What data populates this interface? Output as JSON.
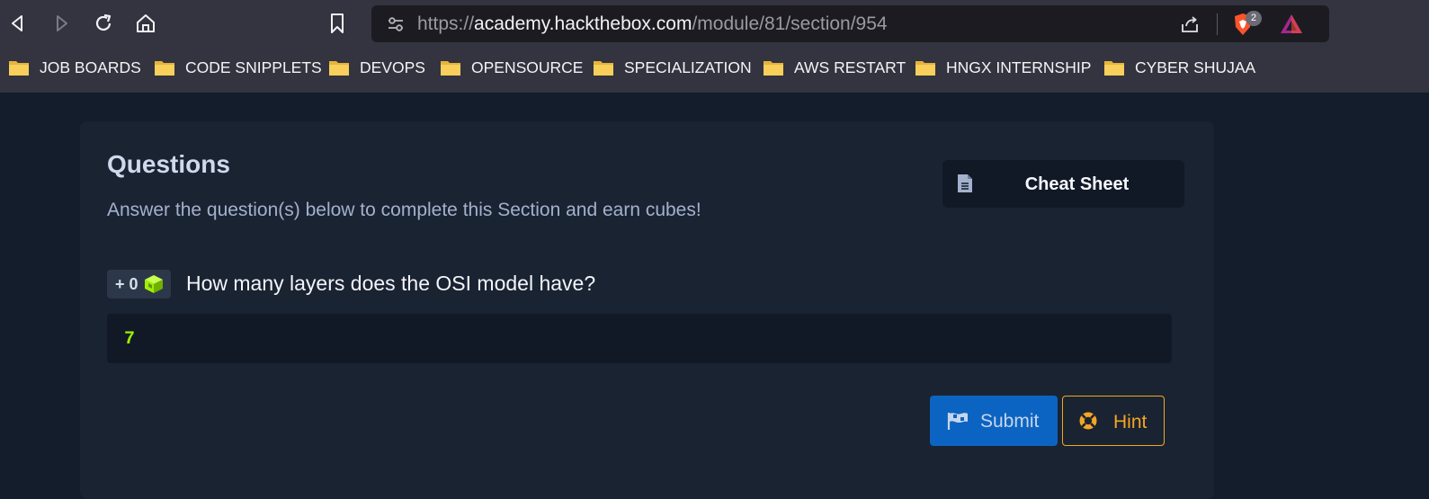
{
  "browser": {
    "url_scheme": "https://",
    "url_host": "academy.hackthebox.com",
    "url_path": "/module/81/section/954",
    "brave_badge_count": "2",
    "bookmarks": [
      {
        "label": "JOB BOARDS"
      },
      {
        "label": "CODE SNIPPLETS"
      },
      {
        "label": "DEVOPS"
      },
      {
        "label": "OPENSOURCE"
      },
      {
        "label": "SPECIALIZATION"
      },
      {
        "label": "AWS RESTART"
      },
      {
        "label": "HNGX INTERNSHIP"
      },
      {
        "label": "CYBER SHUJAA"
      }
    ]
  },
  "questions": {
    "title": "Questions",
    "subtitle": "Answer the question(s) below to complete this Section and earn cubes!",
    "cheat_sheet_label": "Cheat Sheet",
    "reward_badge": "+ 0",
    "question_text": "How many layers does the OSI model have?",
    "answer_value": "7",
    "submit_label": "Submit",
    "hint_label": "Hint"
  },
  "colors": {
    "page_bg": "#141d2b",
    "card_bg": "#1a2332",
    "accent_green": "#9fef00",
    "submit_blue": "#0c64c2",
    "hint_orange": "#f5a623"
  }
}
